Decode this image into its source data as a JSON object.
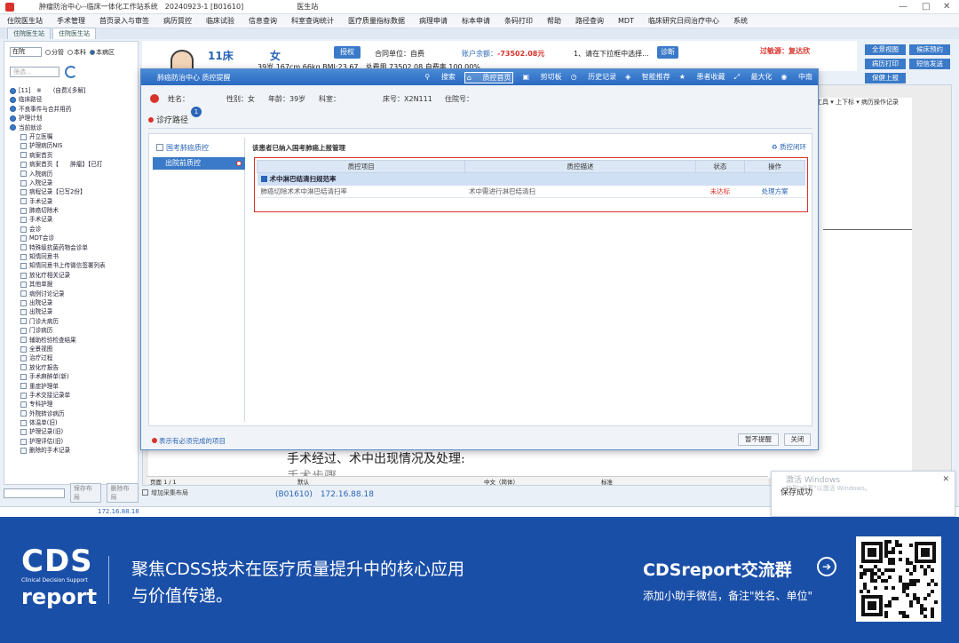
{
  "window": {
    "title": "肿瘤防治中心--临床一体化工作站系统　20240923-1 [B01610]",
    "station": "医生站",
    "controls": [
      "—",
      "□",
      "✕"
    ]
  },
  "menu": [
    "住院医生站",
    "手术管理",
    "首页录入与审签",
    "病历質控",
    "临床试验",
    "信息查询",
    "科室查询统计",
    "医疗质量指标数据",
    "病理申请",
    "标本申请",
    "条码打印",
    "帮助",
    "路径查询",
    "MDT",
    "临床研究日间治疗中心",
    "系统"
  ],
  "tabs": [
    "住院医生站",
    "住院医生站"
  ],
  "left_panel": {
    "filter_value": "在院",
    "radios": [
      "分管",
      "本科",
      "本病区"
    ],
    "selected_radio": "本病区",
    "search_placeholder": "筛选...",
    "tree": [
      {
        "label": "[11]　※　　(自费)[多解]",
        "header": true
      },
      {
        "label": "临床路径",
        "header": true
      },
      {
        "label": "不良事件与合并用药",
        "header": true
      },
      {
        "label": "护理计划",
        "header": true
      },
      {
        "label": "当前就诊",
        "header": true
      },
      {
        "label": "开立医嘱"
      },
      {
        "label": "护理病历NIS"
      },
      {
        "label": "病案首页"
      },
      {
        "label": "病案首页【　　肿瘤】【已打"
      },
      {
        "label": "入院病历"
      },
      {
        "label": "入院记录"
      },
      {
        "label": "病程记录【已写2份】"
      },
      {
        "label": "手术记录"
      },
      {
        "label": "肺癌切除术"
      },
      {
        "label": "手术记录"
      },
      {
        "label": "会诊"
      },
      {
        "label": "MDT会诊"
      },
      {
        "label": "特殊级抗菌药物会诊单"
      },
      {
        "label": "知情同意书"
      },
      {
        "label": "知情同意书上传微信签署列表"
      },
      {
        "label": "放化疗相关记录"
      },
      {
        "label": "其他单据"
      },
      {
        "label": "病例讨论记录"
      },
      {
        "label": "出院记录"
      },
      {
        "label": "出院记录"
      },
      {
        "label": "门诊大病历"
      },
      {
        "label": "门诊病历"
      },
      {
        "label": "辅助检验检查结果"
      },
      {
        "label": "全景视图"
      },
      {
        "label": "治疗过程"
      },
      {
        "label": "放化疗报告"
      },
      {
        "label": "手术麻醉单(新)"
      },
      {
        "label": "重症护理单"
      },
      {
        "label": "手术交接记录单"
      },
      {
        "label": "专科护理"
      },
      {
        "label": "外院转诊病历"
      },
      {
        "label": "体温单(旧)"
      },
      {
        "label": "护理记录(旧)"
      },
      {
        "label": "护理评估(旧)"
      },
      {
        "label": "删除的手术记录"
      }
    ],
    "bottom_buttons": [
      "保存布局",
      "删除布局"
    ]
  },
  "patient": {
    "bed": "11床",
    "sex": "女",
    "auth_label": "授权",
    "contract": "合同单位：自费",
    "balance_label": "账户余额：",
    "balance_value": "-73502.08元",
    "hint": "1、请在下拉框中选择...",
    "diag_label": "诊断",
    "allergy": "过敏源：复达欣",
    "vitals": "39岁 167cm 66kg BMI:23.67　总费用 73502.08 自费率 100.00%"
  },
  "right_buttons": [
    "全景视图",
    "候床预约",
    "病历打印",
    "短信发送",
    "保健上报"
  ],
  "editor": {
    "toolbar": "工具 ▾ 上下标 ▾ 病历操作记录",
    "line1": "手术经过、术中出现情况及处理:",
    "line2": "手术步骤",
    "status": {
      "page": "页面 1 / 1",
      "mode": "默认",
      "lang": "中文（简体）",
      "std": "标准"
    }
  },
  "info_bar": {
    "checkbox_label": "增加采集布局",
    "ip_text": "(B01610)　172.16.88.18"
  },
  "bottom_ip": "172.16.88.18",
  "toast": {
    "text": "保存成功",
    "watermark": "激活 Windows",
    "watermark_sub": "转到\"设置\"以激活 Windows。"
  },
  "modal": {
    "title": "肺癌防治中心 质控提醒",
    "actions": [
      "搜索",
      "质控首页",
      "剪切板",
      "历史记录",
      "智能推荐",
      "患者收藏",
      "最大化",
      "中南"
    ],
    "selected_action": "质控首页",
    "patient_info": {
      "name": "姓名：",
      "sex": "性别：女",
      "age": "年龄：39岁",
      "dept": "科室：",
      "bed": "床号：X2N111",
      "inpatient_no": "住院号："
    },
    "path_tab": "诊疗路径",
    "path_badge": "1",
    "nav": [
      "国考肺癌质控",
      "出院前质控"
    ],
    "content_title": "该患者已纳入国考肺癌上报管理",
    "loop_label": "质控闭环",
    "table": {
      "headers": [
        "质控项目",
        "质控描述",
        "状态",
        "操作"
      ],
      "group": "术中淋巴结清扫规范率",
      "rows": [
        {
          "item": "肺癌切除术术中淋巴结清扫率",
          "desc": "术中需进行淋巴结清扫",
          "status": "未达标",
          "action": "处理方案"
        }
      ]
    },
    "legend": "表示有必须完成的项目",
    "buttons": [
      "暂不提醒",
      "关闭"
    ]
  },
  "banner": {
    "logo_top": "CDS",
    "logo_mid": "Clinical Decision Support",
    "logo_bottom": "report",
    "slogan_line1": "聚焦CDSS技术在医疗质量提升中的核心应用",
    "slogan_line2": "与价值传递。",
    "group_title": "CDSreport交流群",
    "group_sub": "添加小助手微信，备注\"姓名、单位\""
  },
  "colors": {
    "accent": "#3a7ac8",
    "alert": "#d9332b",
    "banner": "#1a4fa8"
  }
}
